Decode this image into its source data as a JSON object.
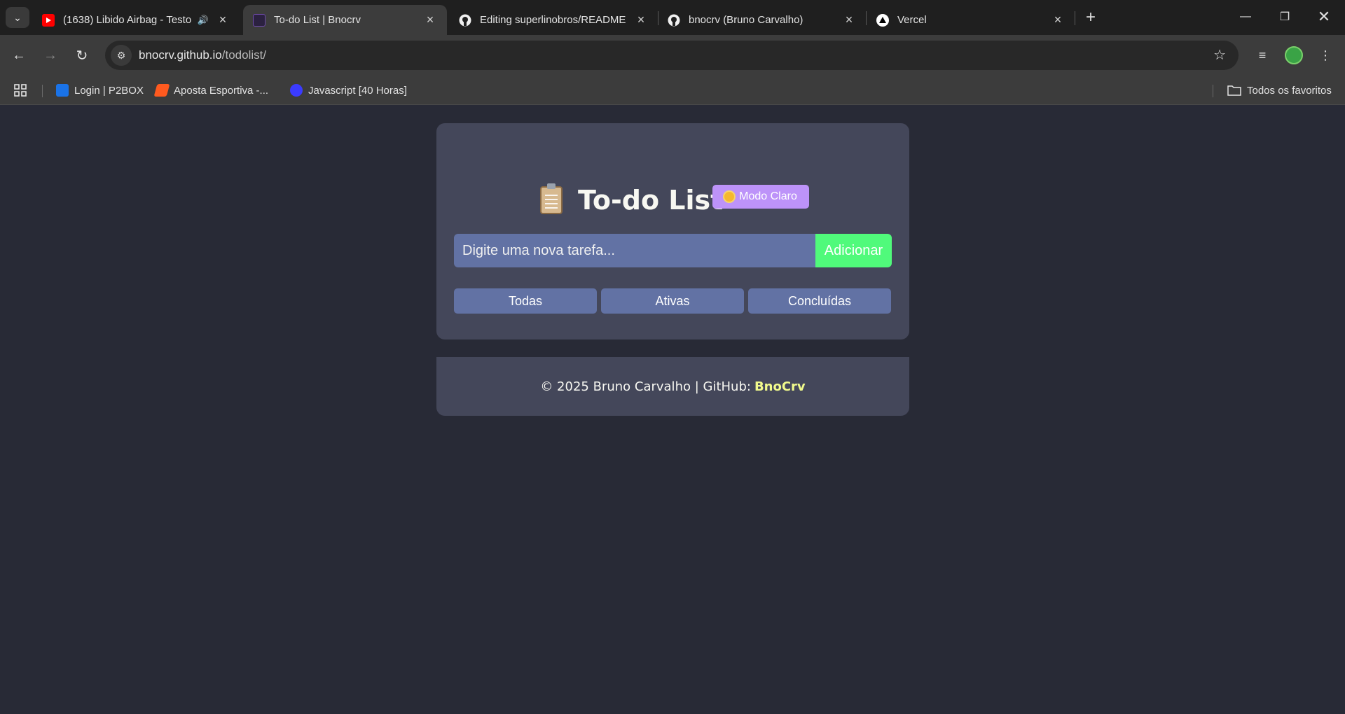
{
  "tabs": [
    {
      "title": "(1638) Libido Airbag - Testo",
      "favicon": "youtube-icon",
      "audio": true
    },
    {
      "title": "To-do List | Bnocrv",
      "favicon": "todo-favicon",
      "active": true
    },
    {
      "title": "Editing superlinobros/README",
      "favicon": "github-icon"
    },
    {
      "title": "bnocrv (Bruno Carvalho)",
      "favicon": "github-icon"
    },
    {
      "title": "Vercel",
      "favicon": "vercel-icon"
    }
  ],
  "address": {
    "host": "bnocrv.github.io",
    "path": "/todolist/"
  },
  "bookmarks": [
    {
      "label": "Login | P2BOX",
      "color": "#1a73e8"
    },
    {
      "label": "Aposta Esportiva -...",
      "color": "#ff5a1f"
    },
    {
      "label": "Javascript [40 Horas]",
      "color": "#3b3bff"
    }
  ],
  "bookmarks_all": "Todos os favoritos",
  "app": {
    "title": "To-do List",
    "mode_button": "Modo Claro",
    "input_placeholder": "Digite uma nova tarefa...",
    "add_button": "Adicionar",
    "filters": [
      "Todas",
      "Ativas",
      "Concluídas"
    ]
  },
  "footer": {
    "text": "© 2025 Bruno Carvalho | GitHub:",
    "link": "BnoCrv"
  },
  "colors": {
    "background": "#282a36",
    "card": "#44475a",
    "accent_purple": "#bd93f9",
    "accent_green": "#50fa7b",
    "input": "#6272a4",
    "link_yellow": "#f1fa8c"
  }
}
